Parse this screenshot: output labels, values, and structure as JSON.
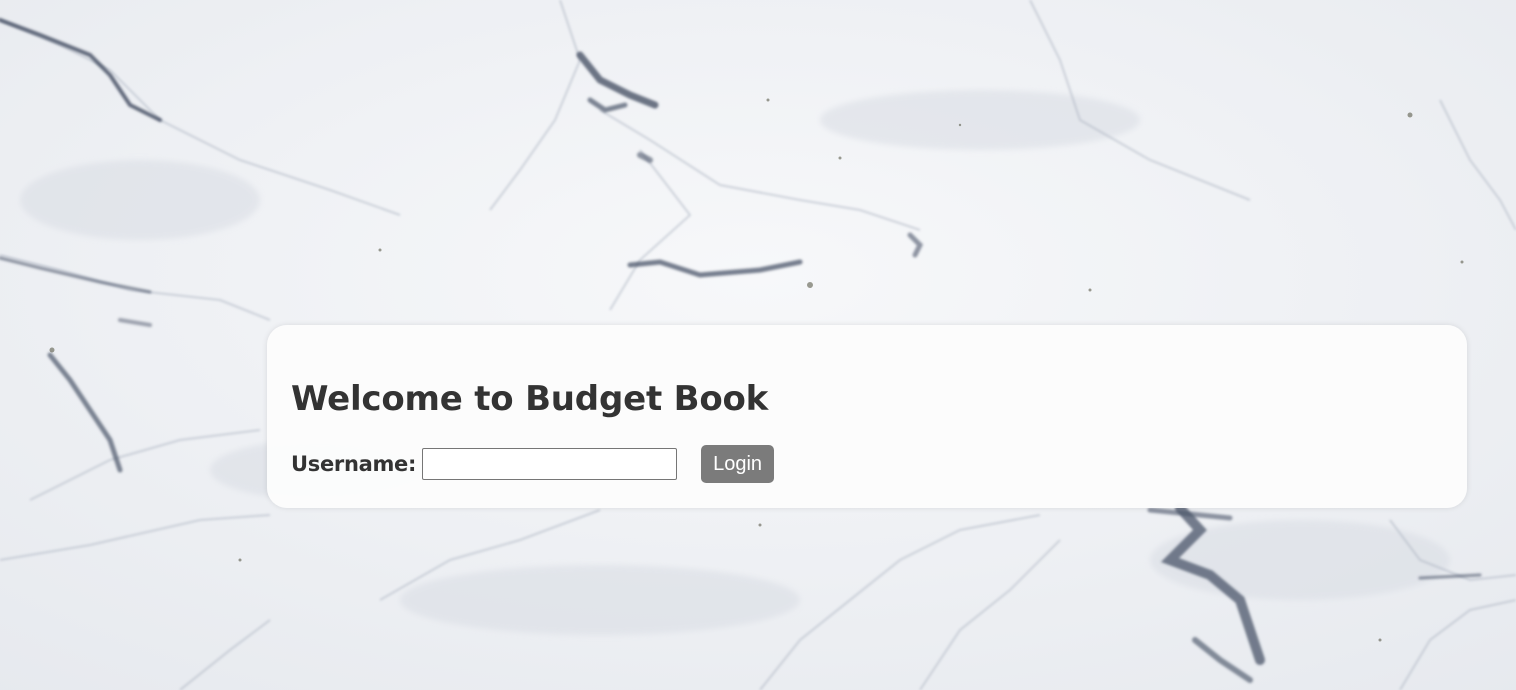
{
  "page": {
    "title": "Welcome to Budget Book"
  },
  "login_form": {
    "username_label": "Username:",
    "username_value": "",
    "login_button": "Login"
  },
  "colors": {
    "card_background": "#fcfcfc",
    "text": "#333333",
    "button_background": "#7b7b7b",
    "button_text": "#ffffff"
  }
}
